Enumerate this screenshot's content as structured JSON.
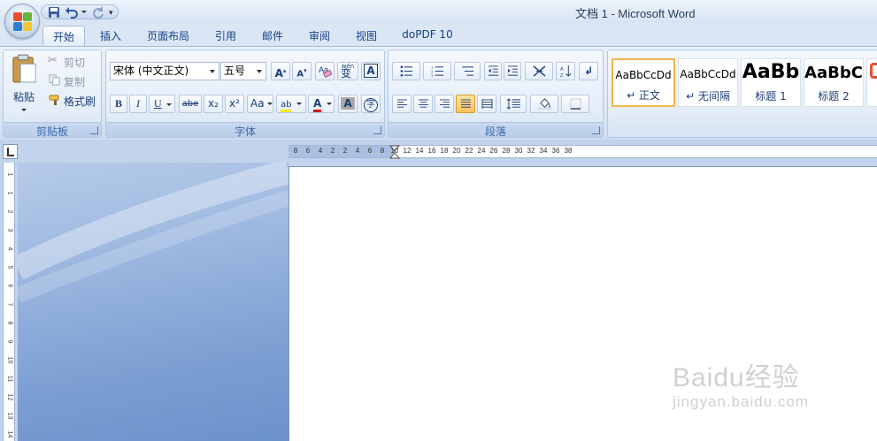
{
  "window": {
    "title": "文档 1 - Microsoft Word"
  },
  "qat": {
    "icons": [
      "save-icon",
      "undo-icon",
      "redo-icon",
      "customize-icon"
    ]
  },
  "tabs": [
    {
      "label": "开始",
      "active": true
    },
    {
      "label": "插入"
    },
    {
      "label": "页面布局"
    },
    {
      "label": "引用"
    },
    {
      "label": "邮件"
    },
    {
      "label": "审阅"
    },
    {
      "label": "视图"
    },
    {
      "label": "doPDF 10"
    }
  ],
  "clipboard": {
    "paste_label": "粘贴",
    "cut_label": "剪切",
    "copy_label": "复制",
    "format_painter_label": "格式刷",
    "group_label": "剪贴板"
  },
  "font": {
    "font_name": "宋体 (中文正文)",
    "font_size": "五号",
    "grow_label": "A",
    "shrink_label": "A",
    "phonetic_label": "wén",
    "phonetic_char": "变",
    "border_char_label": "A",
    "bold": "B",
    "italic": "I",
    "underline": "U",
    "strike": "abe",
    "subscript": "x₂",
    "superscript": "x²",
    "change_case": "Aa",
    "highlight": "ab",
    "font_color": "A",
    "shading": "A",
    "enclose": "字",
    "group_label": "字体"
  },
  "paragraph": {
    "group_label": "段落"
  },
  "styles": {
    "items": [
      {
        "sample": "AaBbCcDd",
        "name": "↵ 正文"
      },
      {
        "sample": "AaBbCcDd",
        "name": "↵ 无间隔"
      },
      {
        "sample": "AaBb",
        "name": "标题 1"
      },
      {
        "sample": "AaBbC",
        "name": "标题 2"
      }
    ]
  },
  "ruler": {
    "h_marks": [
      "8",
      "6",
      "4",
      "2",
      "2",
      "4",
      "6",
      "8",
      "10",
      "12",
      "14",
      "16",
      "18",
      "20",
      "22",
      "24",
      "26",
      "28",
      "30",
      "32",
      "34",
      "36",
      "38"
    ],
    "v_marks": [
      "1",
      "1",
      "2",
      "3",
      "4",
      "5",
      "6",
      "7",
      "8",
      "9",
      "10",
      "11",
      "12",
      "13",
      "14"
    ]
  },
  "watermark": {
    "brand": "Baidu经验",
    "url": "jingyan.baidu.com"
  },
  "colors": {
    "accent": "#15428b",
    "workspace": "#7d9fd2",
    "active_style_border": "#f0b54a"
  }
}
